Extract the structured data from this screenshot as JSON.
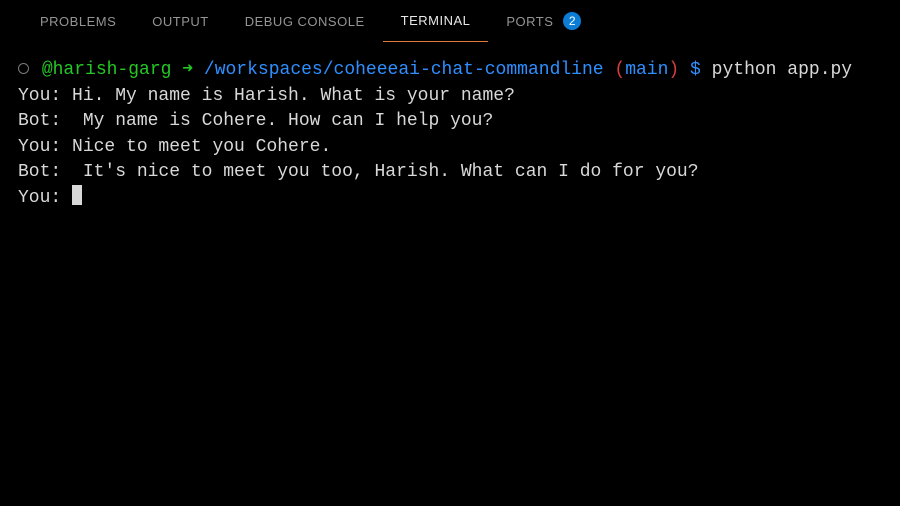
{
  "tabs": {
    "problems": "PROBLEMS",
    "output": "OUTPUT",
    "debug_console": "DEBUG CONSOLE",
    "terminal": "TERMINAL",
    "ports": "PORTS",
    "ports_badge": "2"
  },
  "prompt": {
    "username": "@harish-garg",
    "arrow": "➜",
    "path": "/workspaces/coheeeai-chat-commandline",
    "branch_open": "(",
    "branch": "main",
    "branch_close": ")",
    "dollar": "$",
    "command": "python app.py"
  },
  "chat": [
    {
      "speaker": "You:",
      "text": " Hi. My name is Harish. What is your name?"
    },
    {
      "speaker": "Bot:",
      "text": "  My name is Cohere. How can I help you?"
    },
    {
      "speaker": "You:",
      "text": " Nice to meet you Cohere."
    },
    {
      "speaker": "Bot:",
      "text": "  It's nice to meet you too, Harish. What can I do for you?"
    },
    {
      "speaker": "You:",
      "text": " "
    }
  ]
}
